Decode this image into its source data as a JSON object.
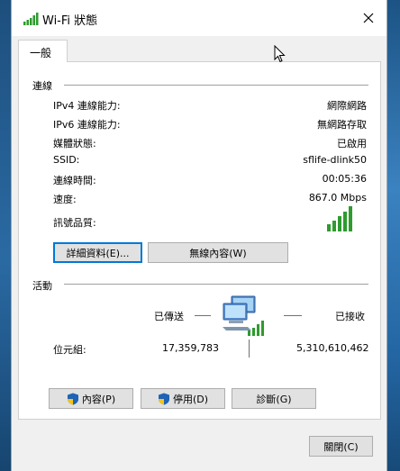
{
  "window": {
    "title": "Wi-Fi 狀態",
    "close_icon": "close-icon"
  },
  "tab": {
    "label": "一般"
  },
  "connection": {
    "section_label": "連線",
    "rows": [
      {
        "label": "IPv4 連線能力:",
        "value": "網際網路"
      },
      {
        "label": "IPv6 連線能力:",
        "value": "無網路存取"
      },
      {
        "label": "媒體狀態:",
        "value": "已啟用"
      },
      {
        "label": "SSID:",
        "value": "sflife-dlink50"
      },
      {
        "label": "連線時間:",
        "value": "00:05:36"
      },
      {
        "label": "速度:",
        "value": "867.0 Mbps"
      }
    ],
    "signal_label": "訊號品質:",
    "signal_bars": 5,
    "signal_bars_active": 5,
    "details_button": "詳細資料(E)...",
    "wireless_props_button": "無線內容(W)"
  },
  "activity": {
    "section_label": "活動",
    "sent_label": "已傳送",
    "received_label": "已接收",
    "bytes_label": "位元組:",
    "bytes_sent": "17,359,783",
    "bytes_received": "5,310,610,462"
  },
  "actions": {
    "properties_button": "內容(P)",
    "disable_button": "停用(D)",
    "diagnose_button": "診斷(G)"
  },
  "footer": {
    "close_button": "關閉(C)"
  },
  "colors": {
    "signal": "#2e9b2e",
    "focus": "#0078d7",
    "shield_blue": "#1e63b5",
    "shield_yellow": "#f5c518"
  }
}
